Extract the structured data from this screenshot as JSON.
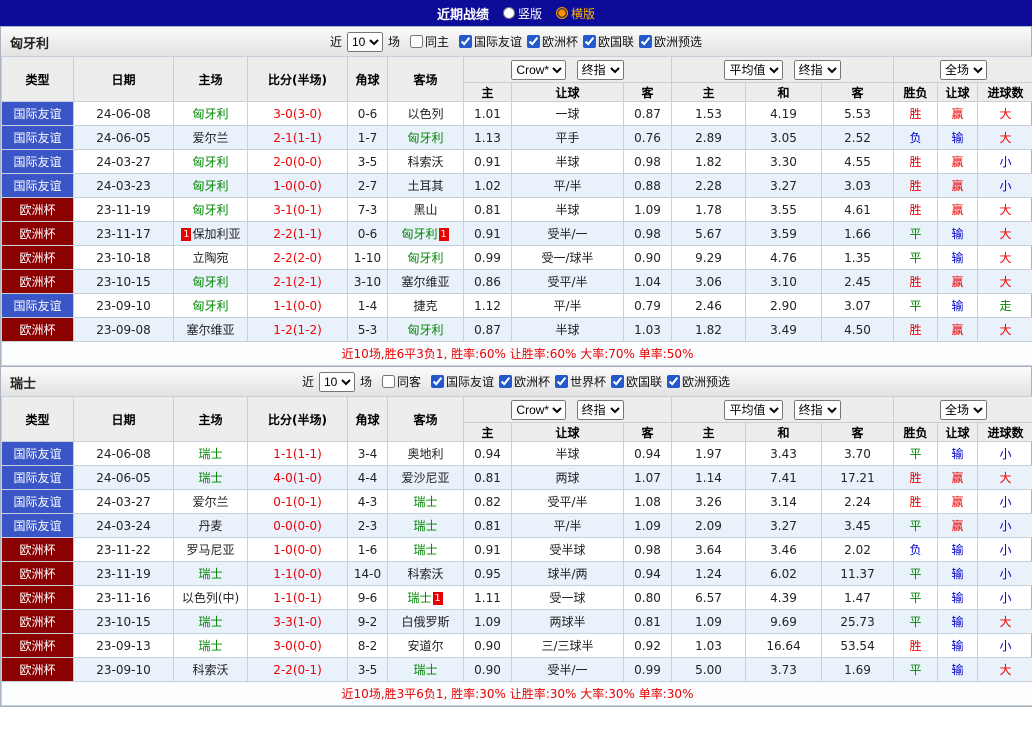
{
  "title_bar": {
    "title": "近期战绩",
    "options": [
      {
        "label": "竖版",
        "selected": false
      },
      {
        "label": "横版",
        "selected": true
      }
    ]
  },
  "labels": {
    "near": "近",
    "games": "场"
  },
  "dropdowns": {
    "bookmaker": "Crow*",
    "final_odds": "终指",
    "average": "平均值",
    "full_match": "全场"
  },
  "columns": {
    "type": "类型",
    "date": "日期",
    "home": "主场",
    "score": "比分(半场)",
    "corner": "角球",
    "away": "客场",
    "asia_home": "主",
    "asia_line": "让球",
    "asia_away": "客",
    "eu_home": "主",
    "eu_draw": "和",
    "eu_away": "客",
    "result": "胜负",
    "line_result": "让球",
    "goals": "进球数"
  },
  "colors": {
    "title_bar_bg": "#0c0c99",
    "friendly_type_bg": "#3a55c6",
    "euro_type_bg": "#8b0000",
    "focus_team_green": "#008800",
    "score_red": "#f00000",
    "win_red": "#f00000",
    "draw_green": "#008800",
    "lose_blue": "#0000cc",
    "selected_layout_orange": "#ffb400",
    "row_stripe": "#e9f1fb"
  },
  "sections": [
    {
      "team": "匈牙利",
      "filter": {
        "count": "10",
        "same_label": "同主",
        "competitions": [
          "国际友谊",
          "欧洲杯",
          "欧国联",
          "欧洲预选"
        ]
      },
      "rows": [
        {
          "comp": "国际友谊",
          "lg": "friendly",
          "date": "24-06-08",
          "home": "匈牙利",
          "hf": true,
          "score": "3-0(3-0)",
          "corner": "0-6",
          "away": "以色列",
          "af": false,
          "ah": "1.01",
          "line": "一球",
          "aa": "0.87",
          "eh": "1.53",
          "ed": "4.19",
          "ea": "5.53",
          "res": "胜",
          "lres": "赢",
          "gres": "大"
        },
        {
          "comp": "国际友谊",
          "lg": "friendly",
          "date": "24-06-05",
          "home": "爱尔兰",
          "hf": false,
          "score": "2-1(1-1)",
          "corner": "1-7",
          "away": "匈牙利",
          "af": true,
          "ah": "1.13",
          "line": "平手",
          "aa": "0.76",
          "eh": "2.89",
          "ed": "3.05",
          "ea": "2.52",
          "res": "负",
          "lres": "输",
          "gres": "大"
        },
        {
          "comp": "国际友谊",
          "lg": "friendly",
          "date": "24-03-27",
          "home": "匈牙利",
          "hf": true,
          "score": "2-0(0-0)",
          "corner": "3-5",
          "away": "科索沃",
          "af": false,
          "ah": "0.91",
          "line": "半球",
          "aa": "0.98",
          "eh": "1.82",
          "ed": "3.30",
          "ea": "4.55",
          "res": "胜",
          "lres": "赢",
          "gres": "小"
        },
        {
          "comp": "国际友谊",
          "lg": "friendly",
          "date": "24-03-23",
          "home": "匈牙利",
          "hf": true,
          "score": "1-0(0-0)",
          "corner": "2-7",
          "away": "土耳其",
          "af": false,
          "ah": "1.02",
          "line": "平/半",
          "aa": "0.88",
          "eh": "2.28",
          "ed": "3.27",
          "ea": "3.03",
          "res": "胜",
          "lres": "赢",
          "gres": "小"
        },
        {
          "comp": "欧洲杯",
          "lg": "euro",
          "date": "23-11-19",
          "home": "匈牙利",
          "hf": true,
          "score": "3-1(0-1)",
          "corner": "7-3",
          "away": "黑山",
          "af": false,
          "ah": "0.81",
          "line": "半球",
          "aa": "1.09",
          "eh": "1.78",
          "ed": "3.55",
          "ea": "4.61",
          "res": "胜",
          "lres": "赢",
          "gres": "大"
        },
        {
          "comp": "欧洲杯",
          "lg": "euro",
          "date": "23-11-17",
          "home": "保加利亚",
          "hf": false,
          "hb": "1",
          "score": "2-2(1-1)",
          "corner": "0-6",
          "away": "匈牙利",
          "af": true,
          "ab": "1",
          "ah": "0.91",
          "line": "受半/一",
          "aa": "0.98",
          "eh": "5.67",
          "ed": "3.59",
          "ea": "1.66",
          "res": "平",
          "lres": "输",
          "gres": "大"
        },
        {
          "comp": "欧洲杯",
          "lg": "euro",
          "date": "23-10-18",
          "home": "立陶宛",
          "hf": false,
          "score": "2-2(2-0)",
          "corner": "1-10",
          "away": "匈牙利",
          "af": true,
          "ah": "0.99",
          "line": "受一/球半",
          "aa": "0.90",
          "eh": "9.29",
          "ed": "4.76",
          "ea": "1.35",
          "res": "平",
          "lres": "输",
          "gres": "大"
        },
        {
          "comp": "欧洲杯",
          "lg": "euro",
          "date": "23-10-15",
          "home": "匈牙利",
          "hf": true,
          "score": "2-1(2-1)",
          "corner": "3-10",
          "away": "塞尔维亚",
          "af": false,
          "ah": "0.86",
          "line": "受平/半",
          "aa": "1.04",
          "eh": "3.06",
          "ed": "3.10",
          "ea": "2.45",
          "res": "胜",
          "lres": "赢",
          "gres": "大"
        },
        {
          "comp": "国际友谊",
          "lg": "friendly",
          "date": "23-09-10",
          "home": "匈牙利",
          "hf": true,
          "score": "1-1(0-0)",
          "corner": "1-4",
          "away": "捷克",
          "af": false,
          "ah": "1.12",
          "line": "平/半",
          "aa": "0.79",
          "eh": "2.46",
          "ed": "2.90",
          "ea": "3.07",
          "res": "平",
          "lres": "输",
          "gres": "走"
        },
        {
          "comp": "欧洲杯",
          "lg": "euro",
          "date": "23-09-08",
          "home": "塞尔维亚",
          "hf": false,
          "score": "1-2(1-2)",
          "corner": "5-3",
          "away": "匈牙利",
          "af": true,
          "ah": "0.87",
          "line": "半球",
          "aa": "1.03",
          "eh": "1.82",
          "ed": "3.49",
          "ea": "4.50",
          "res": "胜",
          "lres": "赢",
          "gres": "大"
        }
      ],
      "summary": "近10场,胜6平3负1, 胜率:60% 让胜率:60% 大率:70% 单率:50%"
    },
    {
      "team": "瑞士",
      "filter": {
        "count": "10",
        "same_label": "同客",
        "competitions": [
          "国际友谊",
          "欧洲杯",
          "世界杯",
          "欧国联",
          "欧洲预选"
        ]
      },
      "rows": [
        {
          "comp": "国际友谊",
          "lg": "friendly",
          "date": "24-06-08",
          "home": "瑞士",
          "hf": true,
          "score": "1-1(1-1)",
          "corner": "3-4",
          "away": "奥地利",
          "af": false,
          "ah": "0.94",
          "line": "半球",
          "aa": "0.94",
          "eh": "1.97",
          "ed": "3.43",
          "ea": "3.70",
          "res": "平",
          "lres": "输",
          "gres": "小"
        },
        {
          "comp": "国际友谊",
          "lg": "friendly",
          "date": "24-06-05",
          "home": "瑞士",
          "hf": true,
          "score": "4-0(1-0)",
          "corner": "4-4",
          "away": "爱沙尼亚",
          "af": false,
          "ah": "0.81",
          "line": "两球",
          "aa": "1.07",
          "eh": "1.14",
          "ed": "7.41",
          "ea": "17.21",
          "res": "胜",
          "lres": "赢",
          "gres": "大"
        },
        {
          "comp": "国际友谊",
          "lg": "friendly",
          "date": "24-03-27",
          "home": "爱尔兰",
          "hf": false,
          "score": "0-1(0-1)",
          "corner": "4-3",
          "away": "瑞士",
          "af": true,
          "ah": "0.82",
          "line": "受平/半",
          "aa": "1.08",
          "eh": "3.26",
          "ed": "3.14",
          "ea": "2.24",
          "res": "胜",
          "lres": "赢",
          "gres": "小"
        },
        {
          "comp": "国际友谊",
          "lg": "friendly",
          "date": "24-03-24",
          "home": "丹麦",
          "hf": false,
          "score": "0-0(0-0)",
          "corner": "2-3",
          "away": "瑞士",
          "af": true,
          "ah": "0.81",
          "line": "平/半",
          "aa": "1.09",
          "eh": "2.09",
          "ed": "3.27",
          "ea": "3.45",
          "res": "平",
          "lres": "赢",
          "gres": "小"
        },
        {
          "comp": "欧洲杯",
          "lg": "euro",
          "date": "23-11-22",
          "home": "罗马尼亚",
          "hf": false,
          "score": "1-0(0-0)",
          "corner": "1-6",
          "away": "瑞士",
          "af": true,
          "ah": "0.91",
          "line": "受半球",
          "aa": "0.98",
          "eh": "3.64",
          "ed": "3.46",
          "ea": "2.02",
          "res": "负",
          "lres": "输",
          "gres": "小"
        },
        {
          "comp": "欧洲杯",
          "lg": "euro",
          "date": "23-11-19",
          "home": "瑞士",
          "hf": true,
          "score": "1-1(0-0)",
          "corner": "14-0",
          "away": "科索沃",
          "af": false,
          "ah": "0.95",
          "line": "球半/两",
          "aa": "0.94",
          "eh": "1.24",
          "ed": "6.02",
          "ea": "11.37",
          "res": "平",
          "lres": "输",
          "gres": "小"
        },
        {
          "comp": "欧洲杯",
          "lg": "euro",
          "date": "23-11-16",
          "home": "以色列(中)",
          "hf": false,
          "score": "1-1(0-1)",
          "corner": "9-6",
          "away": "瑞士",
          "af": true,
          "ab": "1",
          "ah": "1.11",
          "line": "受一球",
          "aa": "0.80",
          "eh": "6.57",
          "ed": "4.39",
          "ea": "1.47",
          "res": "平",
          "lres": "输",
          "gres": "小"
        },
        {
          "comp": "欧洲杯",
          "lg": "euro",
          "date": "23-10-15",
          "home": "瑞士",
          "hf": true,
          "score": "3-3(1-0)",
          "corner": "9-2",
          "away": "白俄罗斯",
          "af": false,
          "ah": "1.09",
          "line": "两球半",
          "aa": "0.81",
          "eh": "1.09",
          "ed": "9.69",
          "ea": "25.73",
          "res": "平",
          "lres": "输",
          "gres": "大"
        },
        {
          "comp": "欧洲杯",
          "lg": "euro",
          "date": "23-09-13",
          "home": "瑞士",
          "hf": true,
          "score": "3-0(0-0)",
          "corner": "8-2",
          "away": "安道尔",
          "af": false,
          "ah": "0.90",
          "line": "三/三球半",
          "aa": "0.92",
          "eh": "1.03",
          "ed": "16.64",
          "ea": "53.54",
          "res": "胜",
          "lres": "输",
          "gres": "小"
        },
        {
          "comp": "欧洲杯",
          "lg": "euro",
          "date": "23-09-10",
          "home": "科索沃",
          "hf": false,
          "score": "2-2(0-1)",
          "corner": "3-5",
          "away": "瑞士",
          "af": true,
          "ah": "0.90",
          "line": "受半/一",
          "aa": "0.99",
          "eh": "5.00",
          "ed": "3.73",
          "ea": "1.69",
          "res": "平",
          "lres": "输",
          "gres": "大"
        }
      ],
      "summary": "近10场,胜3平6负1, 胜率:30% 让胜率:30% 大率:30% 单率:30%"
    }
  ]
}
